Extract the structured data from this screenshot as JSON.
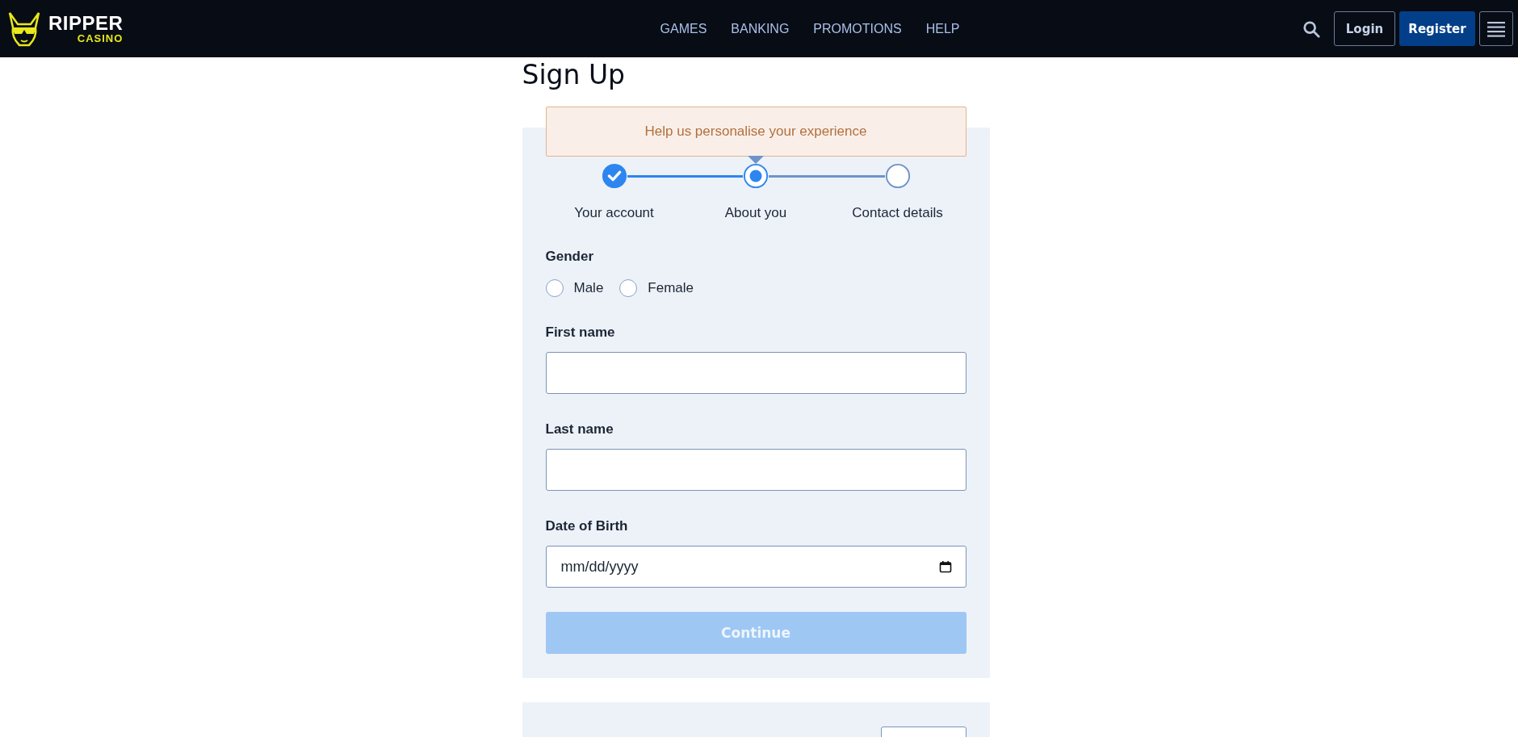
{
  "header": {
    "logo": {
      "word": "RIPPER",
      "sub": "CASINO"
    },
    "nav": [
      {
        "label": "GAMES"
      },
      {
        "label": "BANKING"
      },
      {
        "label": "PROMOTIONS"
      },
      {
        "label": "HELP"
      }
    ],
    "login": "Login",
    "register": "Register"
  },
  "title": "Sign Up",
  "tooltip": "Help us personalise your experience",
  "steps": [
    {
      "label": "Your account",
      "kind": "done"
    },
    {
      "label": "About you",
      "kind": "current"
    },
    {
      "label": "Contact details",
      "kind": "todo"
    }
  ],
  "gender": {
    "label": "Gender",
    "options": [
      {
        "label": "Male",
        "selected": false
      },
      {
        "label": "Female",
        "selected": false
      }
    ]
  },
  "fields": [
    {
      "label": "First name",
      "kind": "text"
    },
    {
      "label": "Last name",
      "kind": "text"
    },
    {
      "label": "Date of Birth",
      "kind": "date",
      "placeholder": "mm/dd/yyyy"
    }
  ],
  "continue": {
    "label": "Continue",
    "disabled": true
  }
}
